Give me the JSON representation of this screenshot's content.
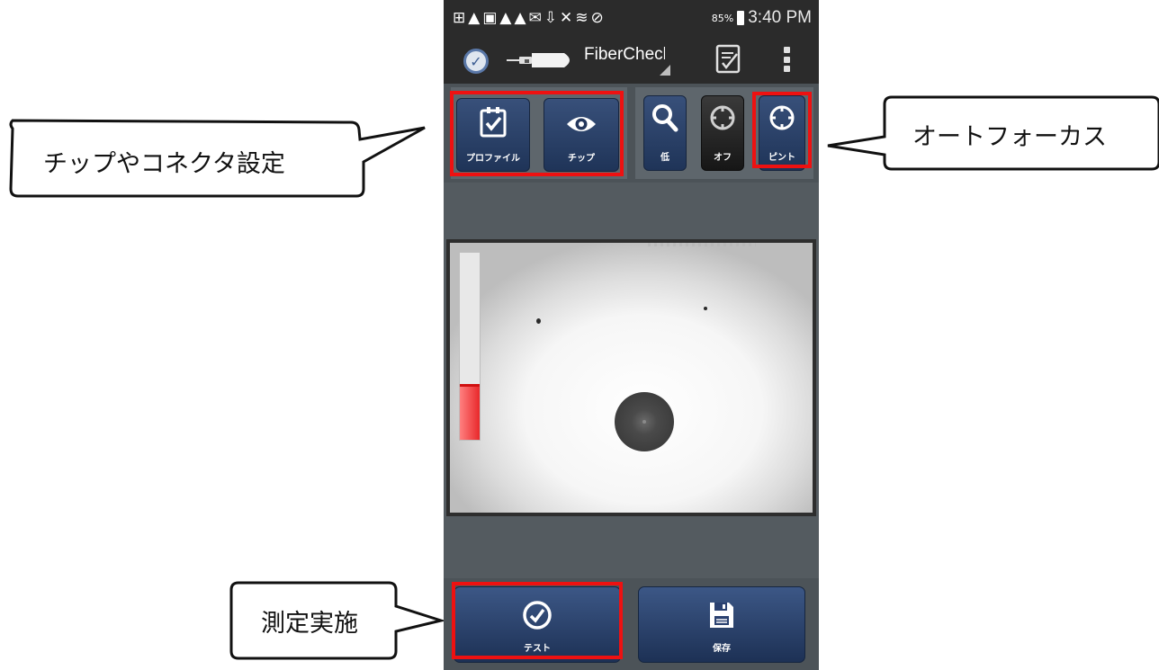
{
  "status_bar": {
    "icons": [
      "add-box-icon",
      "warning-icon",
      "no-sim-icon",
      "warning-icon",
      "warning-icon",
      "mail-icon",
      "download-icon",
      "mute-icon",
      "wifi-icon",
      "blocked-icon"
    ],
    "battery": "85%",
    "time": "3:40 PM"
  },
  "app_bar": {
    "title": "FiberCheck"
  },
  "tools": {
    "profile_label": "プロファイル",
    "tip_label": "チップ",
    "zoom_label": "低",
    "autocenter_label": "オフ",
    "focus_label": "ピント"
  },
  "viewer": {
    "focus_level": 0.3
  },
  "actions": {
    "test_label": "テスト",
    "save_label": "保存"
  },
  "callouts": {
    "chip_settings": "チップやコネクタ設定",
    "autofocus": "オートフォーカス",
    "run_test": "測定実施"
  },
  "colors": {
    "highlight": "#ee1111",
    "button_blue": "#2b4270",
    "focus_bar": "#e8282a"
  }
}
